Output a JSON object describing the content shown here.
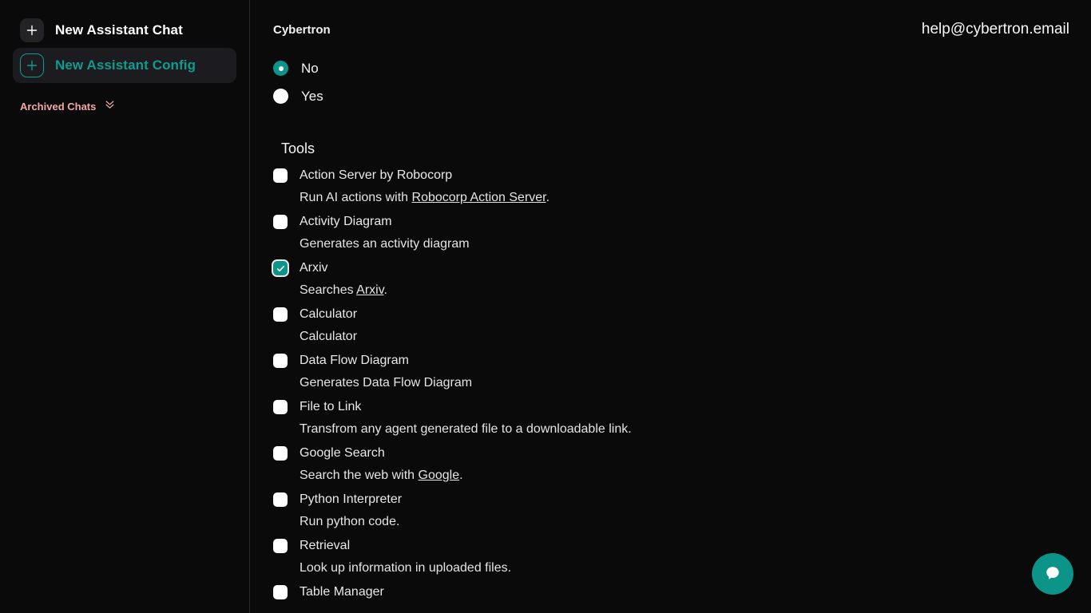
{
  "sidebar": {
    "new_chat": {
      "label": "New Assistant Chat",
      "icon": "plus-icon"
    },
    "new_config": {
      "label": "New Assistant Config",
      "icon": "plus-icon"
    },
    "archived": {
      "label": "Archived Chats",
      "icon": "chevron-double-down-icon"
    }
  },
  "header": {
    "brand": "Cybertron",
    "email": "help@cybertron.email"
  },
  "radio_group": {
    "selected": "No",
    "options": [
      {
        "label": "No",
        "checked": true
      },
      {
        "label": "Yes",
        "checked": false
      }
    ]
  },
  "tools_section": {
    "title": "Tools",
    "items": [
      {
        "name": "Action Server by Robocorp",
        "checked": false,
        "desc_before": "Run AI actions with ",
        "desc_link": "Robocorp Action Server",
        "desc_after": "."
      },
      {
        "name": "Activity Diagram",
        "checked": false,
        "desc_before": "Generates an activity diagram",
        "desc_link": "",
        "desc_after": ""
      },
      {
        "name": "Arxiv",
        "checked": true,
        "desc_before": "Searches ",
        "desc_link": "Arxiv",
        "desc_after": "."
      },
      {
        "name": "Calculator",
        "checked": false,
        "desc_before": "Calculator",
        "desc_link": "",
        "desc_after": ""
      },
      {
        "name": "Data Flow Diagram",
        "checked": false,
        "desc_before": "Generates Data Flow Diagram",
        "desc_link": "",
        "desc_after": ""
      },
      {
        "name": "File to Link",
        "checked": false,
        "desc_before": "Transfrom any agent generated file to a downloadable link.",
        "desc_link": "",
        "desc_after": ""
      },
      {
        "name": "Google Search",
        "checked": false,
        "desc_before": "Search the web with ",
        "desc_link": "Google",
        "desc_after": "."
      },
      {
        "name": "Python Interpreter",
        "checked": false,
        "desc_before": "Run python code.",
        "desc_link": "",
        "desc_after": ""
      },
      {
        "name": "Retrieval",
        "checked": false,
        "desc_before": "Look up information in uploaded files.",
        "desc_link": "",
        "desc_after": ""
      },
      {
        "name": "Table Manager",
        "checked": false,
        "desc_before": "",
        "desc_link": "",
        "desc_after": ""
      }
    ]
  },
  "chat_widget": {
    "icon": "chat-bubble-icon"
  },
  "colors": {
    "accent_teal": "#0d9488",
    "sidebar_active_bg": "#1c1c20",
    "archived_pink": "#f0a9a6",
    "page_bg": "#0a0a0a"
  }
}
